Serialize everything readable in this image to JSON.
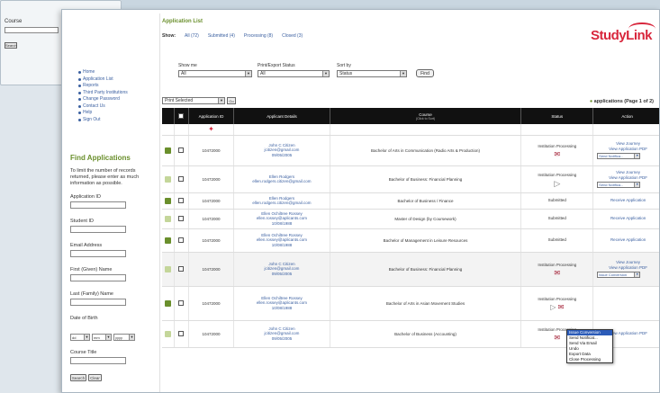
{
  "back_window": {
    "label1": "Course",
    "btn": "Search"
  },
  "nav": {
    "items": [
      "Home",
      "Application List",
      "Reports",
      "Third Party Institutions",
      "Change Password",
      "Contact Us",
      "Help",
      "Sign Out"
    ]
  },
  "find": {
    "title": "Find Applications",
    "description": "To limit the number of records returned, please enter as much information as possible.",
    "fields": {
      "application_id": "Application ID",
      "student_id": "Student ID",
      "email": "Email Address",
      "first_name": "First (Given) Name",
      "last_name": "Last (Family) Name",
      "dob": "Date of Birth",
      "course_title": "Course Title"
    },
    "dob_day": "dd",
    "dob_month": "mm",
    "dob_year": "yyyy",
    "search_btn": "Search",
    "clear_btn": "Clear"
  },
  "main": {
    "title": "Application List",
    "show_label": "Show:",
    "show_links": [
      "All (72)",
      "Submitted (4)",
      "Processing (8)",
      "Closed (3)"
    ],
    "logo": "StudyLink",
    "filters": {
      "show_me_label": "Show me",
      "show_me_value": "All",
      "print_status_label": "Print/Export Status",
      "print_status_value": "All",
      "sort_label": "Sort by",
      "sort_value": "Status",
      "find_btn": "Find"
    },
    "print_select": "Print Selected",
    "go_btn": "Go",
    "count": "applications (Page 1 of 2)"
  },
  "table": {
    "headers": {
      "appid": "Application ID",
      "name": "Applicant Details",
      "course": "Course",
      "course_sub": "(Click to Sort)",
      "status": "Status",
      "action": "Action"
    },
    "rows": [
      {
        "id": "10472000",
        "name": "John C Citizen",
        "email": "jcitizen@gmail.com",
        "dob": "09/05/2005",
        "course": "Bachelor of Arts in Communication (Radio Arts & Production)",
        "status": "Institution Processing",
        "status_icon": "envelope",
        "action1": "View Journey",
        "action2": "View Application PDF",
        "select": "Send Notifica..."
      },
      {
        "id": "10472000",
        "name": "Ellen Rodgers",
        "email": "ellen.rodgers.citizen@gmail.com",
        "dob": "",
        "course": "Bachelor of Business: Financial Planning",
        "status": "Institution Processing",
        "status_icon": "play",
        "action1": "View Journey",
        "action2": "View Application PDF",
        "select": "Send Notifica..."
      },
      {
        "id": "10472000",
        "name": "Ellen Rodgers",
        "email": "ellen.rodgers.citizen@gmail.com",
        "dob": "",
        "course": "Bachelor of Business / Finance",
        "status": "Submitted",
        "status_icon": "",
        "action1": "Receive Application",
        "action2": "",
        "select": ""
      },
      {
        "id": "10472000",
        "name": "Ellen Ochiltree Rossey",
        "email": "ellen.rossey@aplicants.com",
        "dob": "10/08/1988",
        "course": "Master of Design (by Coursework)",
        "status": "Submitted",
        "status_icon": "",
        "action1": "Receive Application",
        "action2": "",
        "select": ""
      },
      {
        "id": "10472000",
        "name": "Ellen Ochiltree Rossey",
        "email": "ellen.rossey@aplicants.com",
        "dob": "10/08/1988",
        "course": "Bachelor of Management in Leisure Resources",
        "status": "Submitted",
        "status_icon": "",
        "action1": "Receive Application",
        "action2": "",
        "select": ""
      },
      {
        "id": "10472000",
        "name": "John C Citizen",
        "email": "jcitizen@gmail.com",
        "dob": "09/05/2005",
        "course": "Bachelor of Business: Financial Planning",
        "status": "Institution Processing",
        "status_icon": "envelope",
        "action1": "View Journey",
        "action2": "View Application PDF",
        "select": "Issue Conversion"
      },
      {
        "id": "10472000",
        "name": "Ellen Ochiltree Rossey",
        "email": "ellen.rossey@aplicants.com",
        "dob": "10/08/1988",
        "course": "Bachelor of Arts in Asian Movement Studies",
        "status": "Institution Processing",
        "status_icon": "both",
        "action1": "",
        "action2": "",
        "select": ""
      },
      {
        "id": "10472000",
        "name": "John C Citizen",
        "email": "jcitizen@gmail.com",
        "dob": "09/05/2005",
        "course": "Bachelor of Business (Accounting)",
        "status": "Institution Processing",
        "status_icon": "envelope",
        "action1": "View Application PDF",
        "action2": "",
        "select": ""
      }
    ]
  },
  "dropdown": {
    "items": [
      "Issue Conversion",
      "Send Notificat...",
      "Send Via Email",
      "Undo",
      "Export Data",
      "Close Processing"
    ],
    "selected_index": 0
  }
}
